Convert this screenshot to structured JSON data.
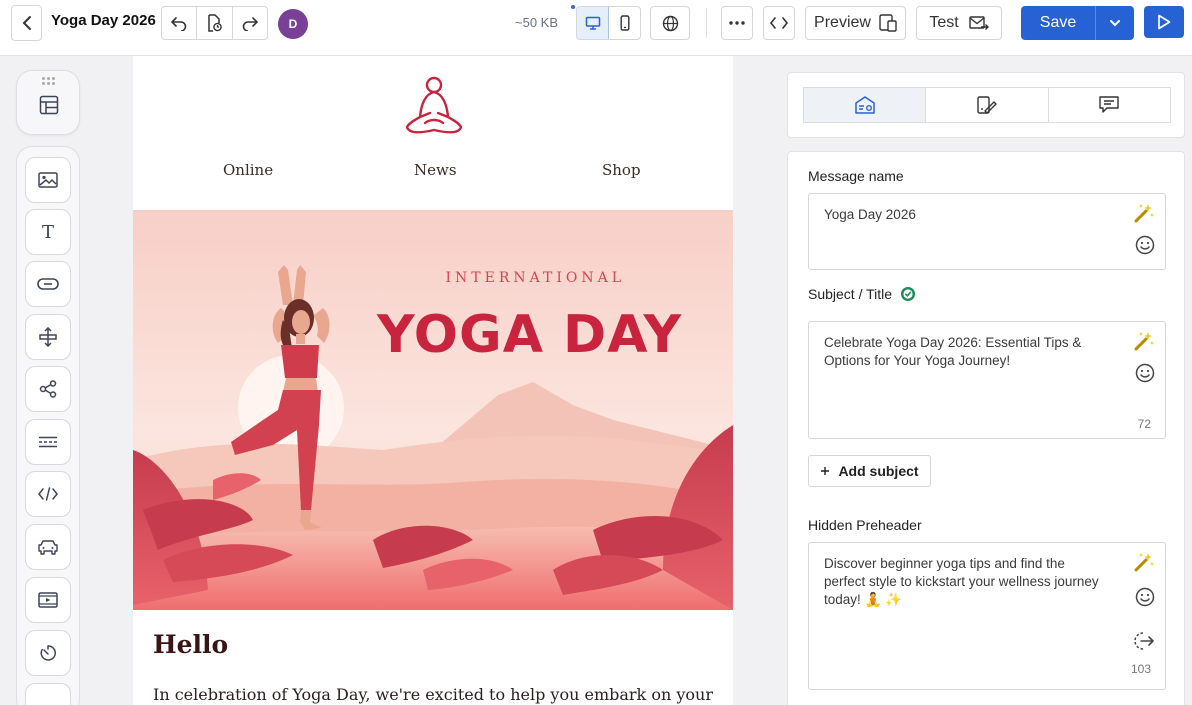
{
  "header": {
    "title": "Yoga Day 2026",
    "avatar_initial": "D",
    "size": "~50 KB",
    "preview_label": "Preview",
    "test_label": "Test",
    "save_label": "Save"
  },
  "colors": {
    "accent": "#2762d4",
    "avatar": "#7a3f97",
    "brand_red": "#c8243d"
  },
  "tools": [
    "image-icon",
    "text-icon",
    "button-icon",
    "spacer-icon",
    "social-icon",
    "menu-icon",
    "html-icon",
    "banner-icon",
    "video-icon",
    "timer-icon"
  ],
  "email": {
    "nav": [
      "Online",
      "News",
      "Shop"
    ],
    "hero_small": "INTERNATIONAL",
    "hero_big": "YOGA DAY",
    "greeting": "Hello",
    "body": "In celebration of Yoga Day, we're excited to help you embark on your"
  },
  "settings": {
    "tabs": [
      "message-settings-tab",
      "design-tab",
      "comments-tab"
    ],
    "message_name": {
      "label": "Message name",
      "value": "Yoga Day 2026"
    },
    "subject": {
      "label": "Subject / Title",
      "value": "Celebrate Yoga Day 2026: Essential Tips & Options for Your Yoga Journey!",
      "count": "72"
    },
    "add_subject_label": "Add subject",
    "preheader": {
      "label": "Hidden Preheader",
      "value": "Discover beginner yoga tips and find the perfect style to kickstart your wellness journey today! 🧘 ✨",
      "count": "103"
    }
  }
}
